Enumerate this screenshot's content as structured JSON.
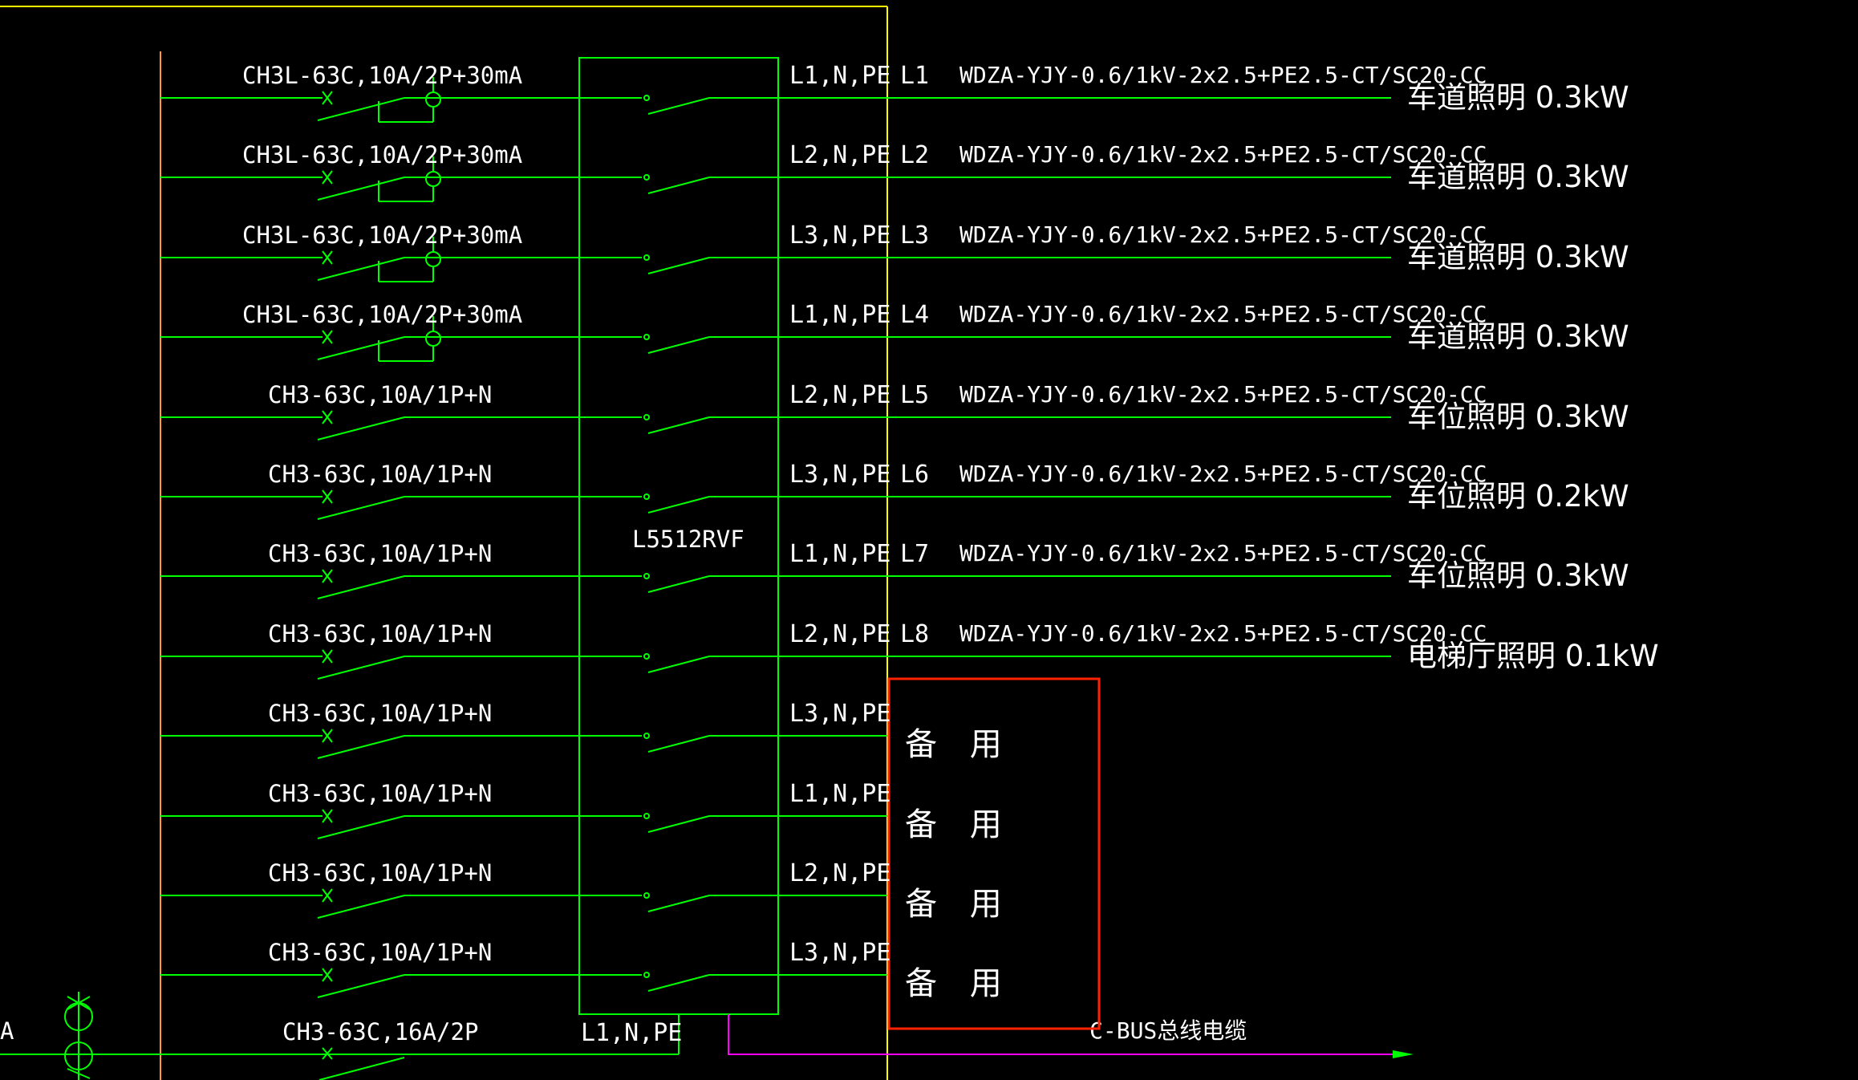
{
  "colors": {
    "background": "#000000",
    "wire": "#00ff00",
    "text": "#ffffff",
    "frame": "#ffff00",
    "busbar": "#ff9933",
    "highlight": "#ff2200",
    "bus_cable": "#ff00ff"
  },
  "controller_label": "L5512RVF",
  "controller_bottom_phase": "L1,N,PE",
  "left_cut_text": "A",
  "bus_cable_label": "C-BUS总线电缆",
  "spare_label": "备 用",
  "incoming_breaker": "CH3-63C,16A/2P",
  "circuits": [
    {
      "breaker": "CH3L-63C,10A/2P+30mA",
      "rcd": true,
      "phase": "L1,N,PE",
      "id": "L1",
      "cable": "WDZA-YJY-0.6/1kV-2x2.5+PE2.5-CT/SC20-CC",
      "load": "车道照明 0.3kW"
    },
    {
      "breaker": "CH3L-63C,10A/2P+30mA",
      "rcd": true,
      "phase": "L2,N,PE",
      "id": "L2",
      "cable": "WDZA-YJY-0.6/1kV-2x2.5+PE2.5-CT/SC20-CC",
      "load": "车道照明 0.3kW"
    },
    {
      "breaker": "CH3L-63C,10A/2P+30mA",
      "rcd": true,
      "phase": "L3,N,PE",
      "id": "L3",
      "cable": "WDZA-YJY-0.6/1kV-2x2.5+PE2.5-CT/SC20-CC",
      "load": "车道照明 0.3kW"
    },
    {
      "breaker": "CH3L-63C,10A/2P+30mA",
      "rcd": true,
      "phase": "L1,N,PE",
      "id": "L4",
      "cable": "WDZA-YJY-0.6/1kV-2x2.5+PE2.5-CT/SC20-CC",
      "load": "车道照明 0.3kW"
    },
    {
      "breaker": "CH3-63C,10A/1P+N",
      "rcd": false,
      "phase": "L2,N,PE",
      "id": "L5",
      "cable": "WDZA-YJY-0.6/1kV-2x2.5+PE2.5-CT/SC20-CC",
      "load": "车位照明 0.3kW"
    },
    {
      "breaker": "CH3-63C,10A/1P+N",
      "rcd": false,
      "phase": "L3,N,PE",
      "id": "L6",
      "cable": "WDZA-YJY-0.6/1kV-2x2.5+PE2.5-CT/SC20-CC",
      "load": "车位照明 0.2kW"
    },
    {
      "breaker": "CH3-63C,10A/1P+N",
      "rcd": false,
      "phase": "L1,N,PE",
      "id": "L7",
      "cable": "WDZA-YJY-0.6/1kV-2x2.5+PE2.5-CT/SC20-CC",
      "load": "车位照明 0.3kW"
    },
    {
      "breaker": "CH3-63C,10A/1P+N",
      "rcd": false,
      "phase": "L2,N,PE",
      "id": "L8",
      "cable": "WDZA-YJY-0.6/1kV-2x2.5+PE2.5-CT/SC20-CC",
      "load": "电梯厅照明 0.1kW"
    },
    {
      "breaker": "CH3-63C,10A/1P+N",
      "rcd": false,
      "phase": "L3,N,PE",
      "spare": true
    },
    {
      "breaker": "CH3-63C,10A/1P+N",
      "rcd": false,
      "phase": "L1,N,PE",
      "spare": true
    },
    {
      "breaker": "CH3-63C,10A/1P+N",
      "rcd": false,
      "phase": "L2,N,PE",
      "spare": true
    },
    {
      "breaker": "CH3-63C,10A/1P+N",
      "rcd": false,
      "phase": "L3,N,PE",
      "spare": true
    }
  ]
}
